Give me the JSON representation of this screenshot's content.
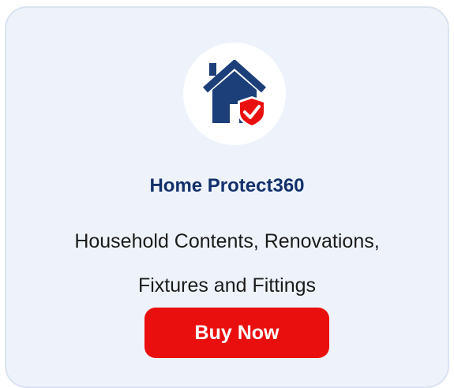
{
  "card": {
    "icon": "house-shield-icon",
    "title": "Home Protect360",
    "subtitle_lines": [
      "Household Contents, Renovations,",
      "Fixtures and Fittings"
    ],
    "button_label": "Buy Now"
  },
  "colors": {
    "card_background": "#eef3fb",
    "card_border": "#d9e3f2",
    "title": "#12306b",
    "house_navy": "#1c3f7a",
    "shield_red": "#ea0f0f",
    "button_background": "#ea0f0f",
    "button_text": "#ffffff"
  }
}
